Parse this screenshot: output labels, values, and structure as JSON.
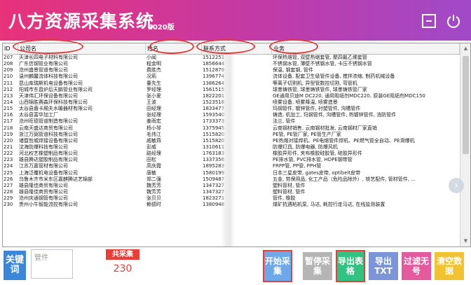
{
  "window": {
    "title": "八方资源采集系统",
    "version": "2020版"
  },
  "table": {
    "columns": [
      "ID",
      "公司名",
      "姓名",
      "联系方式",
      "业务"
    ],
    "rows": [
      {
        "id": "207",
        "company": "天津长四电子材料有限公司",
        "name": "小闻",
        "phone": "1512251",
        "business": "环保热熔管, 双壁热缩套管, 聚四氟乙烯套管"
      },
      {
        "id": "208",
        "company": "广东信钢管业有限公司",
        "name": "程金明",
        "phone": "1856644",
        "business": "不锈钢水管, 薄壁不锈钢水管, 卡压不锈钢水管"
      },
      {
        "id": "209",
        "company": "沧州盛景管道有限公司",
        "name": "费胜杰",
        "phone": "1512879",
        "business": "保温, 钢套钢, 管件"
      },
      {
        "id": "210",
        "company": "温州麟馨流体科技有限公司",
        "name": "况莉",
        "phone": "1396774",
        "business": "流体设备, 配套卫生级管件设备, 搅拌浓缩, 制药机械设备"
      },
      {
        "id": "211",
        "company": "昆山库瑞斯机电设备有限公司",
        "name": "董先生",
        "phone": "1386264",
        "business": "等离子切割机, 异型管数控切割, 弯管机"
      },
      {
        "id": "212",
        "company": "阳城市东昌炉后天鹏管业有限公司",
        "name": "罗经理",
        "phone": "1561515",
        "business": "球墨铸铁管, 球墨铸铁管件, 球墨铸铁管厂家"
      },
      {
        "id": "213",
        "company": "天津伟汇环保设备有限公司",
        "name": "张小爱",
        "phone": "1822201",
        "business": "GE通用贝迪M DC220, 通用阻垢剂MDC220, 原装GE阻垢剂MDC150"
      },
      {
        "id": "214",
        "company": "山西锦胜赛森环保科技有限公司",
        "name": "王波",
        "phone": "1523518",
        "business": "喷雾设备, 喷雾降温, 喷雾造景"
      },
      {
        "id": "215",
        "company": "太谷县盎卡厢夫水暖器材有限公司",
        "name": "田经理",
        "phone": "1833477",
        "business": "玛钢管件, 镀锌管件, 衬塑管件, 沟槽管件"
      },
      {
        "id": "216",
        "company": "太谷县富华加工厂",
        "name": "张经理",
        "phone": "1593540",
        "business": "铸造, 机加工, 玛钢管件, 沟槽管件, 热镀锌管件, 消防管件"
      },
      {
        "id": "217",
        "company": "沧州旺德管道制造有限公司",
        "name": "姜雨宏",
        "phone": "1733373",
        "business": "法兰, 管件"
      },
      {
        "id": "218",
        "company": "云南天盛达商贸有限公司",
        "name": "杨小琴",
        "phone": "1375945",
        "business": "云南钢材销售, 云南钢材批发, 云南钢材厂家直销"
      },
      {
        "id": "219",
        "company": "浙江万弼管道科技有限公司",
        "name": "毛伟江",
        "phone": "1515820",
        "business": "PE管, PE管厂家, PE管生产厂家"
      },
      {
        "id": "220",
        "company": "诸暨哲威焊接设备有限公司",
        "name": "戚敏燕",
        "phone": "1515820",
        "business": "PE热熔对接焊机、PE电熔管件焊机、PE燃气管全自动、PE滑爆机"
      },
      {
        "id": "221",
        "company": "沈海防爆科技有限公司",
        "name": "彭威",
        "phone": "1310611",
        "business": "防爆灯具, 防爆电器, 防爆风机"
      },
      {
        "id": "222",
        "company": "河北权艺橡塑制品有限公司",
        "name": "路经理",
        "phone": "1763183",
        "business": "橡胶异形件, 夹布橡胶硅胶管, 硅胶异形件"
      },
      {
        "id": "223",
        "company": "雄县腾达塑胶制品有限公司",
        "name": "田松",
        "phone": "1337356",
        "business": "PE排水管, PVC排水管, HDPE钢带管"
      },
      {
        "id": "224",
        "company": "江苏万嘉管材有限公司",
        "name": "高庆霞",
        "phone": "1895283",
        "business": "FRPP管, PP管, PPH管"
      },
      {
        "id": "225",
        "company": "上海泛覆机电设备有限公司",
        "name": "唐敏",
        "phone": "1580199",
        "business": "日本三星皮带, gates皮带, optibelt皮带"
      },
      {
        "id": "226",
        "company": "乌鲁木齐市米东区嘉麒腾达艺锦部",
        "name": "郑二强",
        "phone": "1509487",
        "business": "五金, 劳保用品, 化工产品（危险品除外）, 铁艺配件, 管材管件, ..."
      },
      {
        "id": "227",
        "company": "雄县隆佳商贸有限公司",
        "name": "魏芳芳",
        "phone": "1347327",
        "business": "塑料管材, 管件"
      },
      {
        "id": "228",
        "company": "雄县隆佳商贸有限公司",
        "name": "魏芳芳",
        "phone": "1347327",
        "business": "塑料管材, 管件"
      },
      {
        "id": "229",
        "company": "沧州庆通钢管有限公司",
        "name": "张贝贝",
        "phone": "1823271",
        "business": "管件, 橡胶"
      },
      {
        "id": "230",
        "company": "贵州小牛智能流控有限公司",
        "name": "赖德时",
        "phone": "1380948",
        "business": "煤矿抗遇粘机泵, 马达, 耗控行走马达, 在线监测装置"
      }
    ]
  },
  "controls": {
    "keyword_button": "关键词",
    "keyword_value": "管件",
    "total_label": "共采集",
    "total_value": "230",
    "start_button": "开始采集",
    "pause_button": "暂停采集",
    "export_button": "导出表格",
    "export_txt_button": "导出TXT",
    "filter_button": "过滤无号",
    "clear_button": "清空数据"
  },
  "colors": {
    "title_gradient_start": "#e8327a",
    "title_gradient_end": "#a04ac8",
    "accent_red": "#e6403a",
    "keyword_blue": "#3b86d9",
    "export_green": "#32c282"
  }
}
